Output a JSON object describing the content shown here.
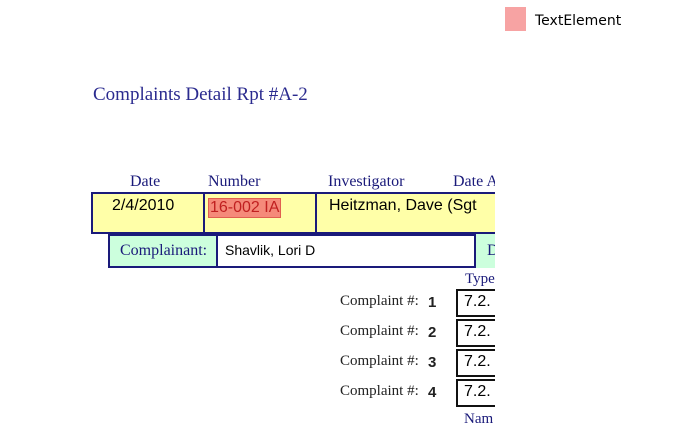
{
  "legend": {
    "label": "TextElement",
    "color": "#f7a3a3"
  },
  "report": {
    "title": "Complaints Detail Rpt #A-2",
    "headers": {
      "date": "Date",
      "number": "Number",
      "investigator": "Investigator",
      "date_a": "Date A"
    },
    "row": {
      "date": "2/4/2010",
      "number": "16-002 IA",
      "investigator": "Heitzman, Dave (Sgt"
    },
    "complainant": {
      "label": "Complainant:",
      "value": "Shavlik, Lori D",
      "d_label": "D"
    },
    "type_header": "Type",
    "name_header": "Nam",
    "complaints": [
      {
        "label": "Complaint #:",
        "num": "1",
        "code": "7.2."
      },
      {
        "label": "Complaint #:",
        "num": "2",
        "code": "7.2."
      },
      {
        "label": "Complaint #:",
        "num": "3",
        "code": "7.2."
      },
      {
        "label": "Complaint #:",
        "num": "4",
        "code": "7.2."
      }
    ]
  }
}
